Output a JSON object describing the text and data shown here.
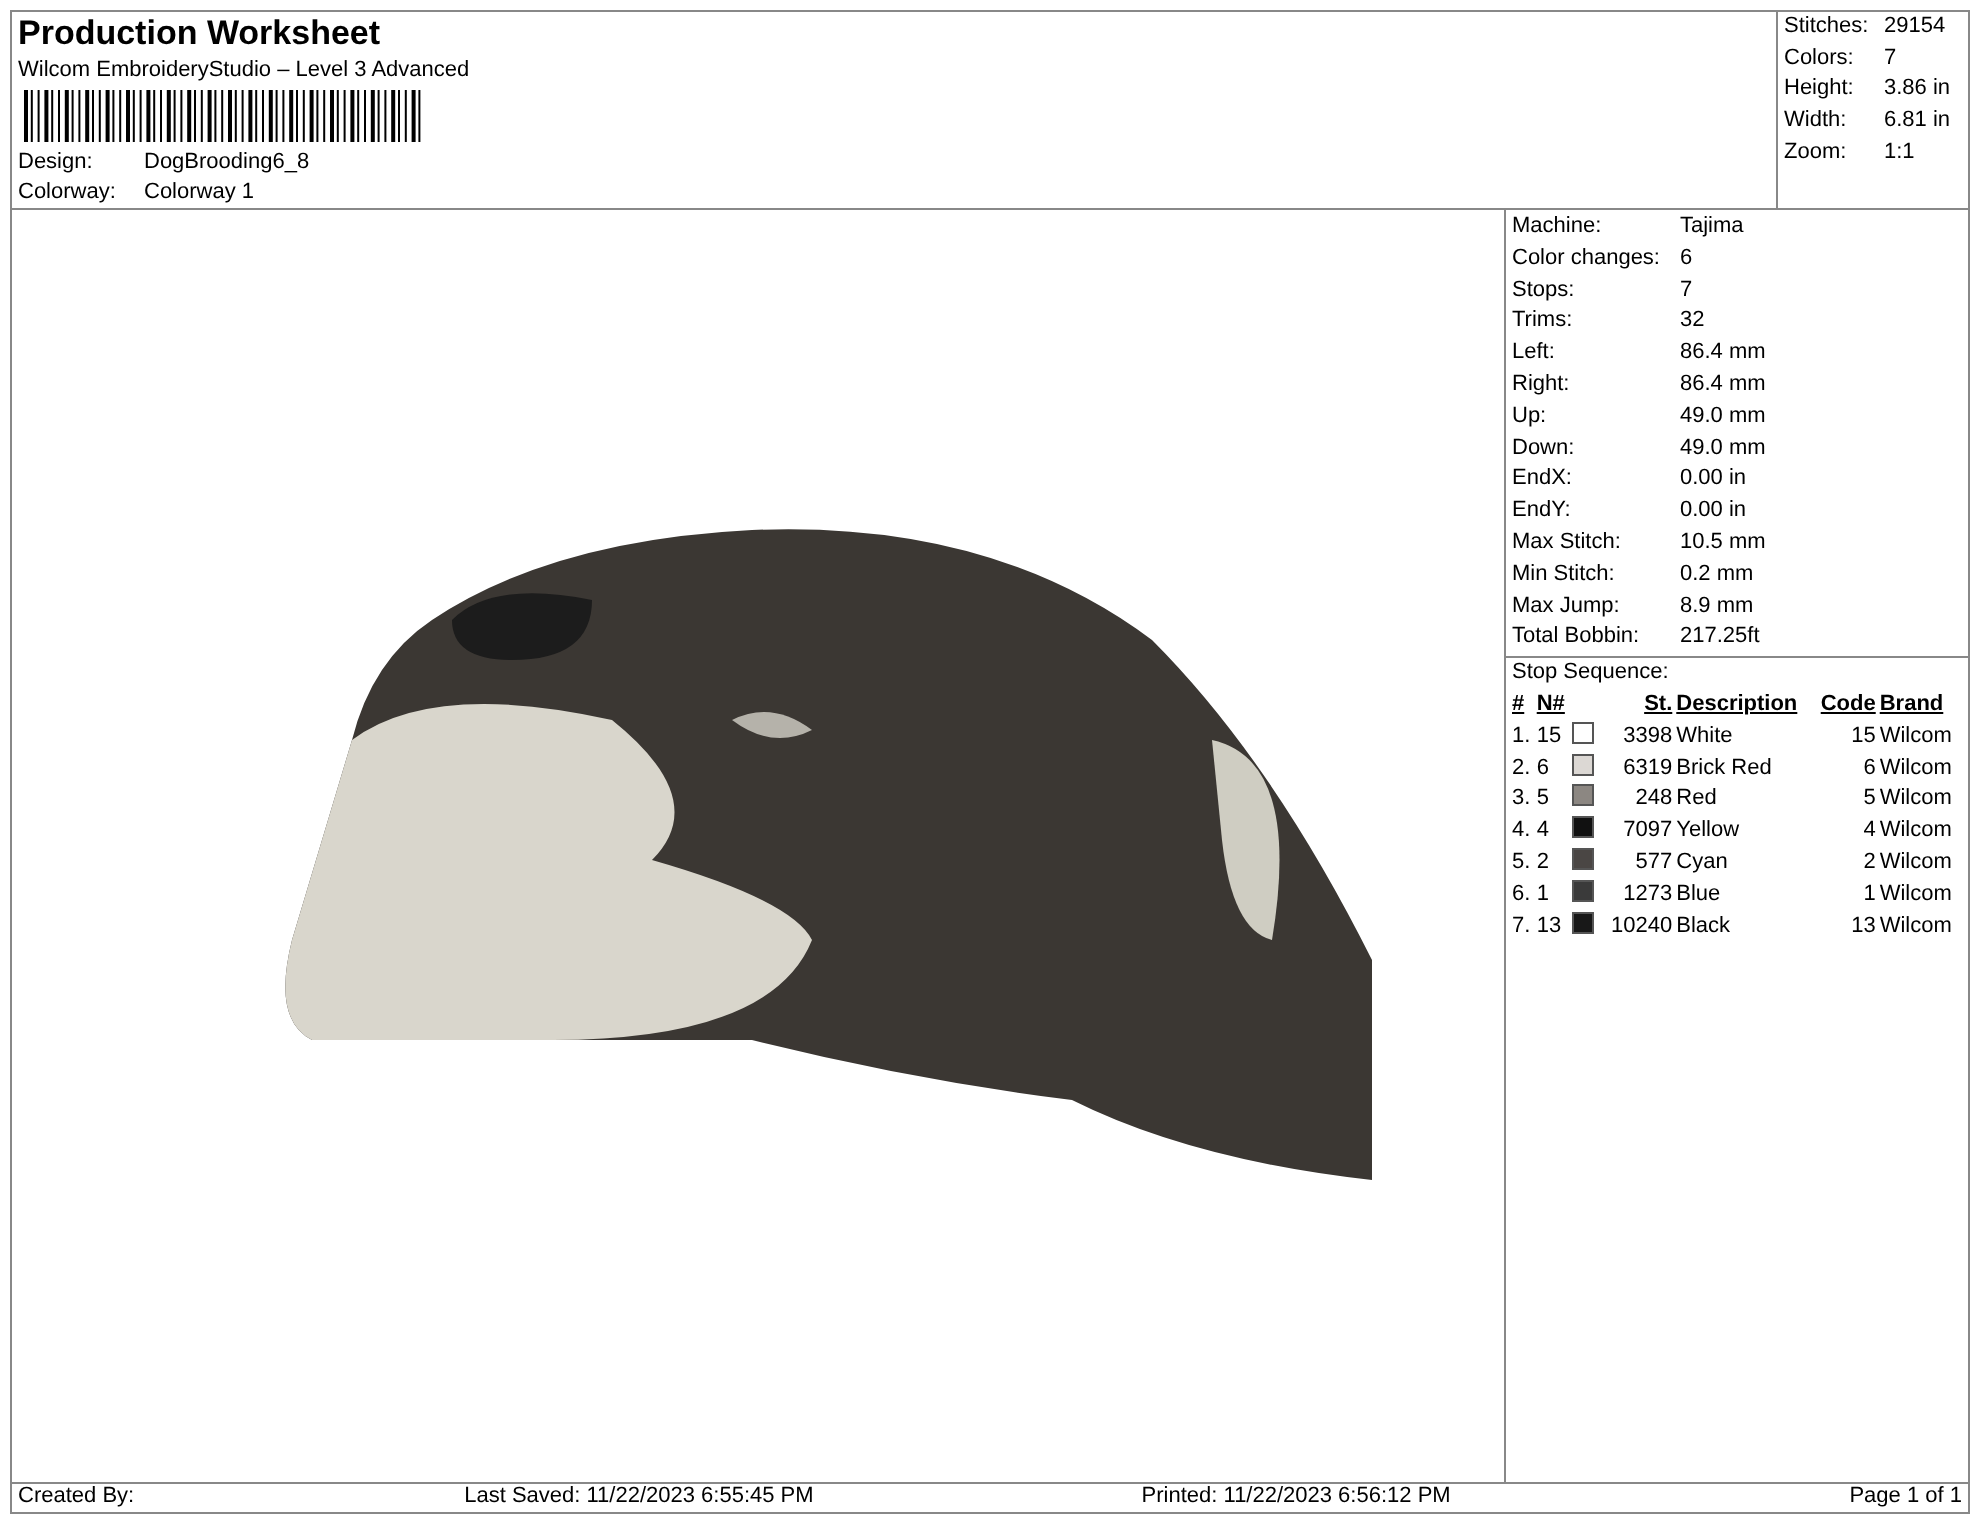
{
  "header": {
    "title": "Production Worksheet",
    "subtitle": "Wilcom EmbroideryStudio – Level 3 Advanced",
    "fields": [
      {
        "label": "Design:",
        "value": "DogBrooding6_8"
      },
      {
        "label": "Colorway:",
        "value": "Colorway 1"
      }
    ]
  },
  "summary": [
    {
      "label": "Stitches:",
      "value": "29154"
    },
    {
      "label": "Colors:",
      "value": "7"
    },
    {
      "label": "Height:",
      "value": "3.86 in"
    },
    {
      "label": "Width:",
      "value": "6.81 in"
    },
    {
      "label": "Zoom:",
      "value": "1:1"
    }
  ],
  "details": [
    {
      "label": "Machine:",
      "value": "Tajima"
    },
    {
      "label": "Color changes:",
      "value": "6"
    },
    {
      "label": "Stops:",
      "value": "7"
    },
    {
      "label": "Trims:",
      "value": "32"
    },
    {
      "label": "Left:",
      "value": "86.4 mm"
    },
    {
      "label": "Right:",
      "value": "86.4 mm"
    },
    {
      "label": "Up:",
      "value": "49.0 mm"
    },
    {
      "label": "Down:",
      "value": "49.0 mm"
    },
    {
      "label": "EndX:",
      "value": "0.00 in"
    },
    {
      "label": "EndY:",
      "value": "0.00 in"
    },
    {
      "label": "Max Stitch:",
      "value": "10.5 mm"
    },
    {
      "label": "Min Stitch:",
      "value": "0.2 mm"
    },
    {
      "label": "Max Jump:",
      "value": "8.9 mm"
    },
    {
      "label": "Total Bobbin:",
      "value": "217.25ft"
    }
  ],
  "stop_sequence": {
    "title": "Stop Sequence:",
    "columns": [
      "#",
      "N#",
      "St.",
      "Description",
      "Code",
      "Brand"
    ],
    "rows": [
      {
        "index": "1.",
        "needle": "15",
        "color": "#ffffff",
        "stitches": "3398",
        "description": "White",
        "code": "15",
        "brand": "Wilcom"
      },
      {
        "index": "2.",
        "needle": "6",
        "color": "#dcd8d4",
        "stitches": "6319",
        "description": "Brick Red",
        "code": "6",
        "brand": "Wilcom"
      },
      {
        "index": "3.",
        "needle": "5",
        "color": "#8c8782",
        "stitches": "248",
        "description": "Red",
        "code": "5",
        "brand": "Wilcom"
      },
      {
        "index": "4.",
        "needle": "4",
        "color": "#111111",
        "stitches": "7097",
        "description": "Yellow",
        "code": "4",
        "brand": "Wilcom"
      },
      {
        "index": "5.",
        "needle": "2",
        "color": "#4a4644",
        "stitches": "577",
        "description": "Cyan",
        "code": "2",
        "brand": "Wilcom"
      },
      {
        "index": "6.",
        "needle": "1",
        "color": "#3a3a3a",
        "stitches": "1273",
        "description": "Blue",
        "code": "1",
        "brand": "Wilcom"
      },
      {
        "index": "7.",
        "needle": "13",
        "color": "#181818",
        "stitches": "10240",
        "description": "Black",
        "code": "13",
        "brand": "Wilcom"
      }
    ]
  },
  "footer": {
    "created_by": "Created By:",
    "last_saved": "Last Saved: 11/22/2023 6:55:45 PM",
    "printed": "Printed: 11/22/2023 6:56:12 PM",
    "page": "Page 1 of 1"
  }
}
